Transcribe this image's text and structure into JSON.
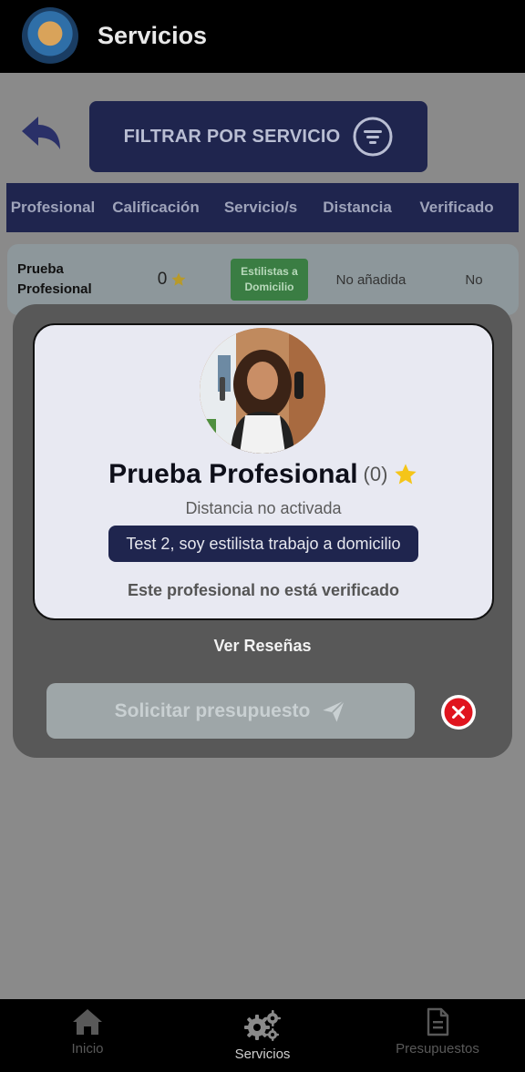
{
  "topbar": {
    "title": "Servicios"
  },
  "filter": {
    "label": "FILTRAR POR SERVICIO"
  },
  "table": {
    "headers": [
      "Profesional",
      "Calificación",
      "Servicio/s",
      "Distancia",
      "Verificado"
    ],
    "rows": [
      {
        "profesional_line1": "Prueba",
        "profesional_line2": "Profesional",
        "rating": "0",
        "service_line1": "Estilistas a",
        "service_line2": "Domicilio",
        "distance": "No añadida",
        "verified": "No"
      }
    ]
  },
  "modal": {
    "name": "Prueba Profesional",
    "review_count": "(0)",
    "distance": "Distancia no activada",
    "description": "Test 2, soy estilista trabajo a domicilio",
    "verification": "Este profesional no está verificado",
    "reviews_link": "Ver Reseñas",
    "request_button": "Solicitar presupuesto"
  },
  "nav": {
    "items": [
      {
        "label": "Inicio",
        "icon": "home-icon",
        "active": false
      },
      {
        "label": "Servicios",
        "icon": "gears-icon",
        "active": true
      },
      {
        "label": "Presupuestos",
        "icon": "document-icon",
        "active": false
      }
    ]
  },
  "colors": {
    "navy": "#1f254e",
    "badge_green": "#3a7d43",
    "close_red": "#e0141e",
    "star": "#f5c518"
  }
}
